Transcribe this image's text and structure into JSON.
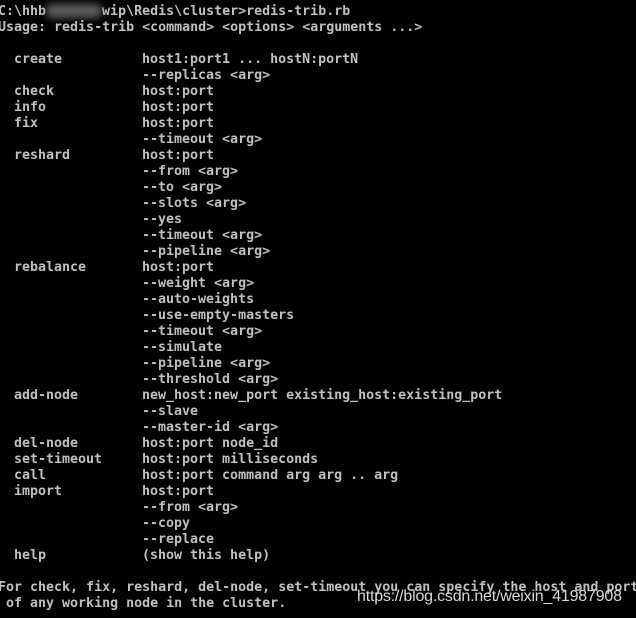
{
  "prompt": {
    "prefix": "C:\\hhb",
    "suffix": "wip\\Redis\\cluster>redis-trib.rb"
  },
  "usage": "Usage: redis-trib <command> <options> <arguments ...>",
  "commands": [
    {
      "cmd": "create",
      "args": [
        "host1:port1 ... hostN:portN",
        "--replicas <arg>"
      ]
    },
    {
      "cmd": "check",
      "args": [
        "host:port"
      ]
    },
    {
      "cmd": "info",
      "args": [
        "host:port"
      ]
    },
    {
      "cmd": "fix",
      "args": [
        "host:port",
        "--timeout <arg>"
      ]
    },
    {
      "cmd": "reshard",
      "args": [
        "host:port",
        "--from <arg>",
        "--to <arg>",
        "--slots <arg>",
        "--yes",
        "--timeout <arg>",
        "--pipeline <arg>"
      ]
    },
    {
      "cmd": "rebalance",
      "args": [
        "host:port",
        "--weight <arg>",
        "--auto-weights",
        "--use-empty-masters",
        "--timeout <arg>",
        "--simulate",
        "--pipeline <arg>",
        "--threshold <arg>"
      ]
    },
    {
      "cmd": "add-node",
      "args": [
        "new_host:new_port existing_host:existing_port",
        "--slave",
        "--master-id <arg>"
      ]
    },
    {
      "cmd": "del-node",
      "args": [
        "host:port node_id"
      ]
    },
    {
      "cmd": "set-timeout",
      "args": [
        "host:port milliseconds"
      ]
    },
    {
      "cmd": "call",
      "args": [
        "host:port command arg arg .. arg"
      ]
    },
    {
      "cmd": "import",
      "args": [
        "host:port",
        "--from <arg>",
        "--copy",
        "--replace"
      ]
    },
    {
      "cmd": "help",
      "args": [
        "(show this help)"
      ]
    }
  ],
  "footer": [
    "For check, fix, reshard, del-node, set-timeout you can specify the host and port",
    " of any working node in the cluster."
  ],
  "watermark": "https://blog.csdn.net/weixin_41987908"
}
